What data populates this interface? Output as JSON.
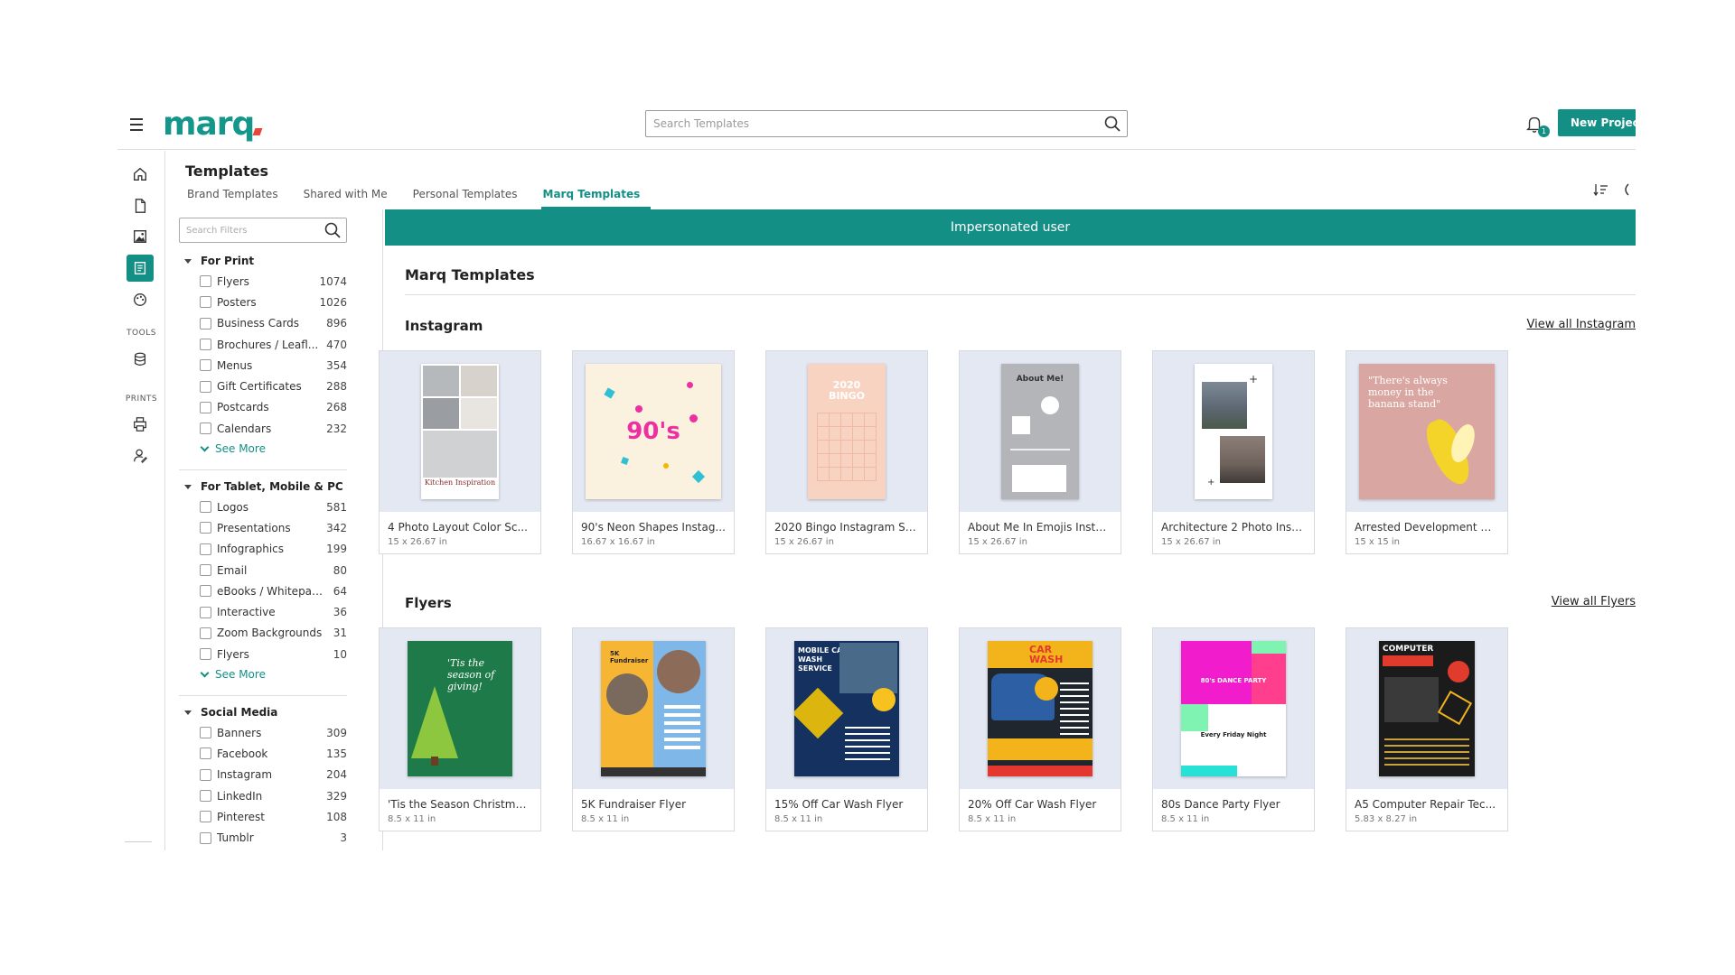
{
  "header": {
    "logo": "marq",
    "search_placeholder": "Search Templates",
    "notification_count": "1",
    "new_project_label": "New Project"
  },
  "rail": {
    "tools_label": "TOOLS",
    "prints_label": "PRINTS"
  },
  "page": {
    "title": "Templates",
    "tabs": [
      "Brand Templates",
      "Shared with Me",
      "Personal Templates",
      "Marq Templates"
    ],
    "active_tab": "Marq Templates"
  },
  "filters": {
    "search_placeholder": "Search Filters",
    "groups": [
      {
        "title": "For Print",
        "items": [
          {
            "label": "Flyers",
            "count": "1074"
          },
          {
            "label": "Posters",
            "count": "1026"
          },
          {
            "label": "Business Cards",
            "count": "896"
          },
          {
            "label": "Brochures / Leafl...",
            "count": "470"
          },
          {
            "label": "Menus",
            "count": "354"
          },
          {
            "label": "Gift Certificates",
            "count": "288"
          },
          {
            "label": "Postcards",
            "count": "268"
          },
          {
            "label": "Calendars",
            "count": "232"
          }
        ],
        "see_more": "See More"
      },
      {
        "title": "For Tablet, Mobile & PC",
        "items": [
          {
            "label": "Logos",
            "count": "581"
          },
          {
            "label": "Presentations",
            "count": "342"
          },
          {
            "label": "Infographics",
            "count": "199"
          },
          {
            "label": "Email",
            "count": "80"
          },
          {
            "label": "eBooks / Whitepap...",
            "count": "64"
          },
          {
            "label": "Interactive",
            "count": "36"
          },
          {
            "label": "Zoom Backgrounds",
            "count": "31"
          },
          {
            "label": "Flyers",
            "count": "10"
          }
        ],
        "see_more": "See More"
      },
      {
        "title": "Social Media",
        "items": [
          {
            "label": "Banners",
            "count": "309"
          },
          {
            "label": "Facebook",
            "count": "135"
          },
          {
            "label": "Instagram",
            "count": "204"
          },
          {
            "label": "LinkedIn",
            "count": "329"
          },
          {
            "label": "Pinterest",
            "count": "108"
          },
          {
            "label": "Tumblr",
            "count": "3"
          }
        ]
      }
    ]
  },
  "main": {
    "banner": "Impersonated user",
    "section_title": "Marq Templates",
    "rows": [
      {
        "title": "Instagram",
        "view_all": "View all Instagram",
        "cards": [
          {
            "name": "4 Photo Layout Color Sc...",
            "size": "15 x 26.67 in",
            "thumb_text": "Kitchen Inspiration"
          },
          {
            "name": "90's Neon Shapes Instag...",
            "size": "16.67 x 16.67 in",
            "thumb_text": "90's"
          },
          {
            "name": "2020 Bingo Instagram St...",
            "size": "15 x 26.67 in",
            "thumb_text": "2020 BINGO"
          },
          {
            "name": "About Me In Emojis Instg...",
            "size": "15 x 26.67 in",
            "thumb_text": "About Me!"
          },
          {
            "name": "Architecture 2 Photo Inst...",
            "size": "15 x 26.67 in",
            "thumb_text": ""
          },
          {
            "name": "Arrested Development Q...",
            "size": "15 x 15 in",
            "thumb_text": "\"There's always money in the banana stand\""
          }
        ]
      },
      {
        "title": "Flyers",
        "view_all": "View all Flyers",
        "cards": [
          {
            "name": "'Tis the Season Christma...",
            "size": "8.5 x 11 in",
            "thumb_text": "'Tis the season of giving!"
          },
          {
            "name": "5K Fundraiser Flyer",
            "size": "8.5 x 11 in",
            "thumb_text": "5K Fundraiser"
          },
          {
            "name": "15% Off Car Wash Flyer",
            "size": "8.5 x 11 in",
            "thumb_text": "MOBILE CAR WASH SERVICE"
          },
          {
            "name": "20% Off Car Wash Flyer",
            "size": "8.5 x 11 in",
            "thumb_text": "CAR WASH"
          },
          {
            "name": "80s Dance Party Flyer",
            "size": "8.5 x 11 in",
            "thumb_text": "80's DANCE PARTY"
          },
          {
            "name": "A5 Computer Repair Tec...",
            "size": "5.83 x 8.27 in",
            "thumb_text": "COMPUTER"
          }
        ]
      }
    ]
  },
  "colors": {
    "brand": "#138f86",
    "text": "#222222"
  }
}
